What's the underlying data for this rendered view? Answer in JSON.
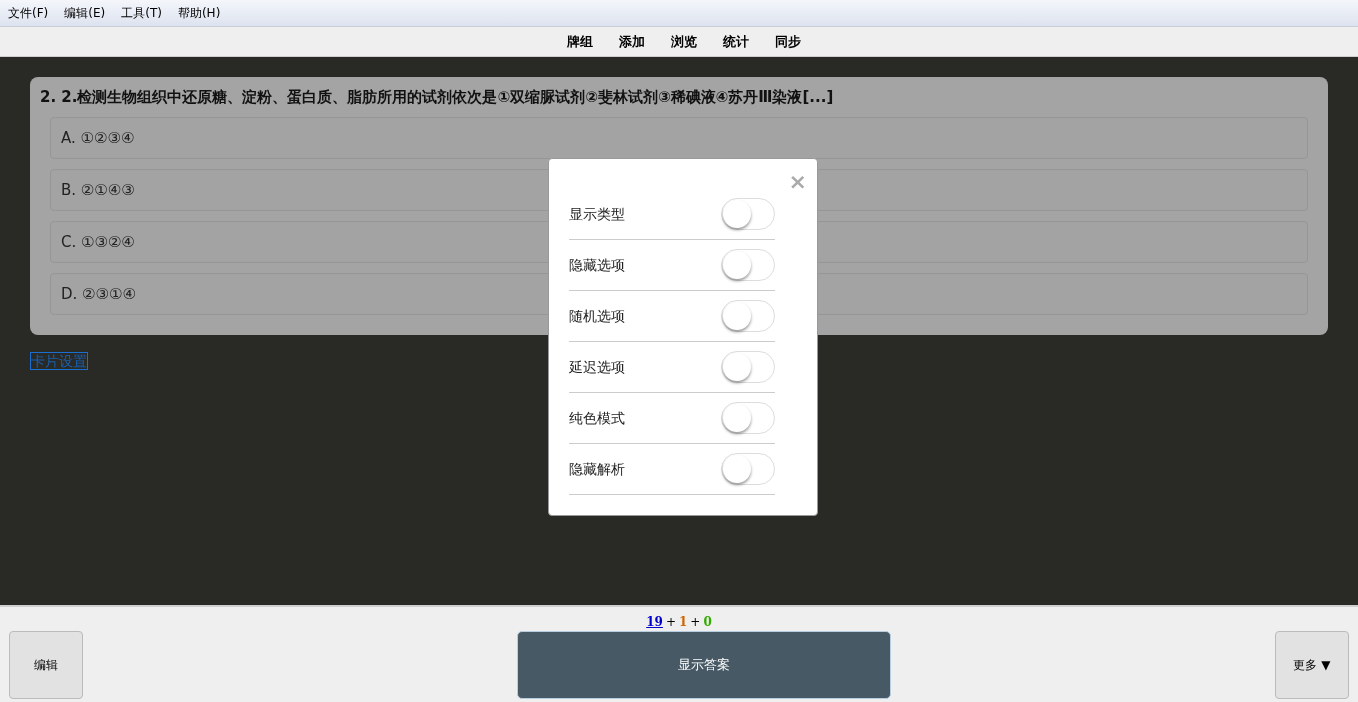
{
  "menu": [
    "文件(F)",
    "编辑(E)",
    "工具(T)",
    "帮助(H)"
  ],
  "nav": [
    "牌组",
    "添加",
    "浏览",
    "统计",
    "同步"
  ],
  "question": {
    "title": "2. 2.检测生物组织中还原糖、淀粉、蛋白质、脂肪所用的试剂依次是①双缩脲试剂②斐林试剂③稀碘液④苏丹Ⅲ染液[...]",
    "options": [
      "A. ①②③④",
      "B. ②①④③",
      "C. ①③②④",
      "D. ②③①④"
    ]
  },
  "card_settings_link": "卡片设置",
  "dialog": {
    "close": "×",
    "settings": [
      {
        "label": "显示类型",
        "on": false
      },
      {
        "label": "隐藏选项",
        "on": false
      },
      {
        "label": "随机选项",
        "on": false
      },
      {
        "label": "延迟选项",
        "on": false
      },
      {
        "label": "纯色模式",
        "on": false
      },
      {
        "label": "隐藏解析",
        "on": false
      }
    ]
  },
  "counts": [
    {
      "value": "19",
      "color": "#0000cc",
      "link": true
    },
    {
      "value": "1",
      "color": "#cc6600",
      "link": false
    },
    {
      "value": "0",
      "color": "#33aa00",
      "link": false
    }
  ],
  "count_separator": "+",
  "buttons": {
    "edit": "编辑",
    "show_answer": "显示答案",
    "more": "更多 ▼"
  }
}
